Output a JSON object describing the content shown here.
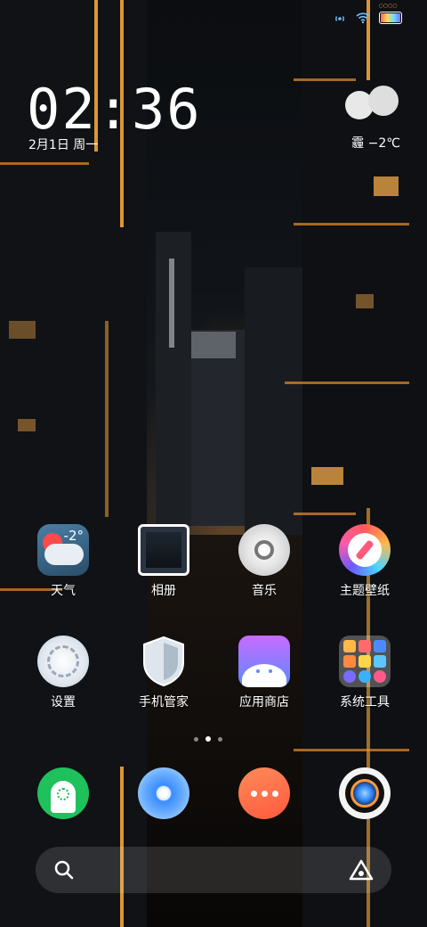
{
  "status_bar": {
    "icons": [
      "hotspot-icon",
      "wifi-icon",
      "battery-icon"
    ],
    "battery_label": "○○○○",
    "battery_level": 1.0
  },
  "clock": {
    "time": "02:36",
    "date": "2月1日 周一"
  },
  "weather": {
    "condition": "霾",
    "temperature": "−2℃"
  },
  "apps_row1": [
    {
      "label": "天气",
      "icon": "weather-app-icon",
      "badge": "-2°"
    },
    {
      "label": "相册",
      "icon": "gallery-icon"
    },
    {
      "label": "音乐",
      "icon": "music-icon"
    },
    {
      "label": "主题壁纸",
      "icon": "themes-icon"
    }
  ],
  "apps_row2": [
    {
      "label": "设置",
      "icon": "settings-icon"
    },
    {
      "label": "手机管家",
      "icon": "phone-manager-icon"
    },
    {
      "label": "应用商店",
      "icon": "app-store-icon"
    },
    {
      "label": "系统工具",
      "icon": "system-tools-folder-icon"
    }
  ],
  "page_indicator": {
    "pages": 3,
    "current": 2
  },
  "dock": [
    {
      "icon": "phone-icon"
    },
    {
      "icon": "browser-icon"
    },
    {
      "icon": "messages-icon"
    },
    {
      "icon": "camera-icon"
    }
  ],
  "search": {
    "left_icon": "search-icon",
    "right_icon": "assistant-icon"
  },
  "colors": {
    "accent": "#ffae3a",
    "dock_green": "#1fc15d",
    "dock_blue": "#3a8cff",
    "dock_orange": "#ff6b3d"
  }
}
